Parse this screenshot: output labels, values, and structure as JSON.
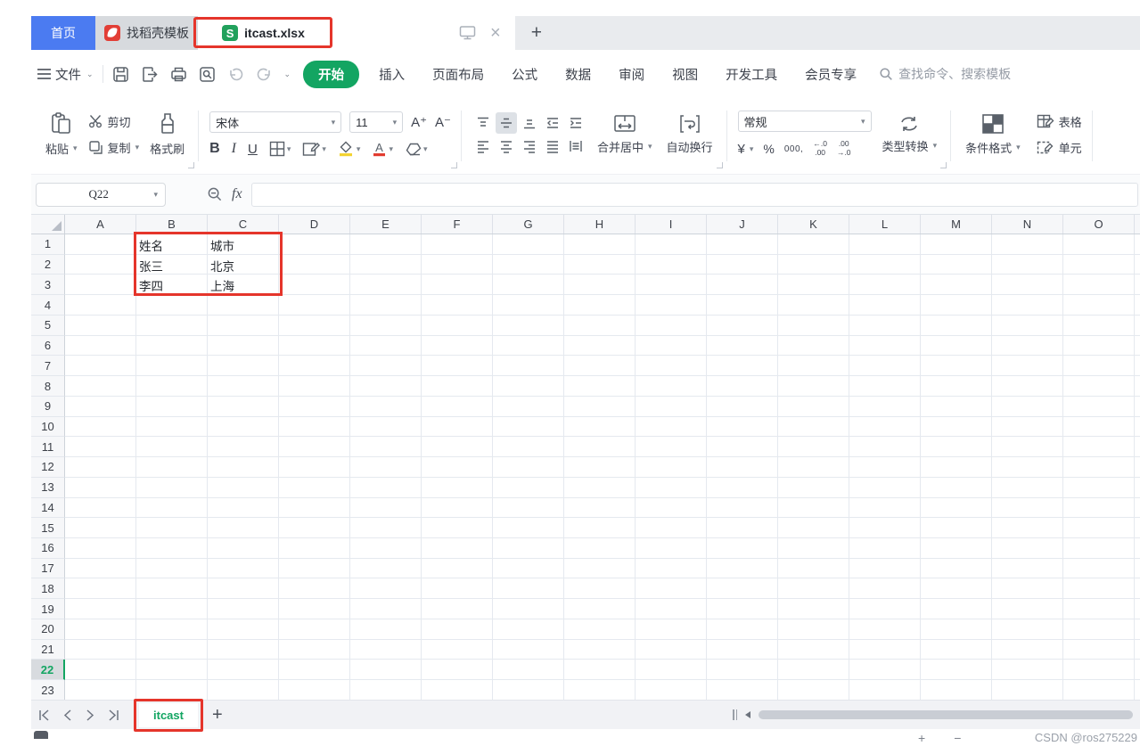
{
  "tabs": {
    "home_label": "首页",
    "docer_label": "找稻壳模板",
    "document_label": "itcast.xlsx",
    "doc_logo_letter": "S"
  },
  "menu": {
    "file_label": "文件",
    "items": [
      "开始",
      "插入",
      "页面布局",
      "公式",
      "数据",
      "审阅",
      "视图",
      "开发工具",
      "会员专享"
    ],
    "active_index": 0,
    "search_placeholder": "查找命令、搜索模板"
  },
  "toolbar": {
    "paste_label": "粘贴",
    "cut_label": "剪切",
    "copy_label": "复制",
    "format_painter_label": "格式刷",
    "font_name": "宋体",
    "font_size": "11",
    "font_bigger": "A⁺",
    "font_smaller": "A⁻",
    "bold": "B",
    "italic": "I",
    "underline": "U",
    "merge_center_label": "合并居中",
    "wrap_text_label": "自动换行",
    "number_format": "常规",
    "currency": "¥",
    "percent": "%",
    "comma_style": "000,",
    "inc_decimal_top": "←.0",
    "inc_decimal_bottom": ".00",
    "dec_decimal_top": ".00",
    "dec_decimal_bottom": "→.0",
    "type_convert_label": "类型转换",
    "conditional_format_label": "条件格式",
    "table_style_label": "表格",
    "cell_style_label": "单元"
  },
  "formula_bar": {
    "cell_reference": "Q22",
    "fx_label": "fx",
    "formula_value": ""
  },
  "grid": {
    "columns": [
      "A",
      "B",
      "C",
      "D",
      "E",
      "F",
      "G",
      "H",
      "I",
      "J",
      "K",
      "L",
      "M",
      "N",
      "O"
    ],
    "row_count": 23,
    "selected_row": 22,
    "cells": {
      "B1": "姓名",
      "C1": "城市",
      "B2": "张三",
      "C2": "北京",
      "B3": "李四",
      "C3": "上海"
    }
  },
  "sheet_bar": {
    "active_sheet": "itcast"
  },
  "status": {
    "watermark": "CSDN @ros275229"
  },
  "icons": {
    "dropdown_caret": "▾",
    "menu_caret": "⌄",
    "close_tab": "×",
    "new_tab": "+",
    "add_sheet": "+"
  },
  "colors": {
    "accent_blue": "#4b7bf1",
    "accent_green": "#13a562",
    "annotation_red": "#e5352b",
    "docer_red": "#e23e36"
  }
}
